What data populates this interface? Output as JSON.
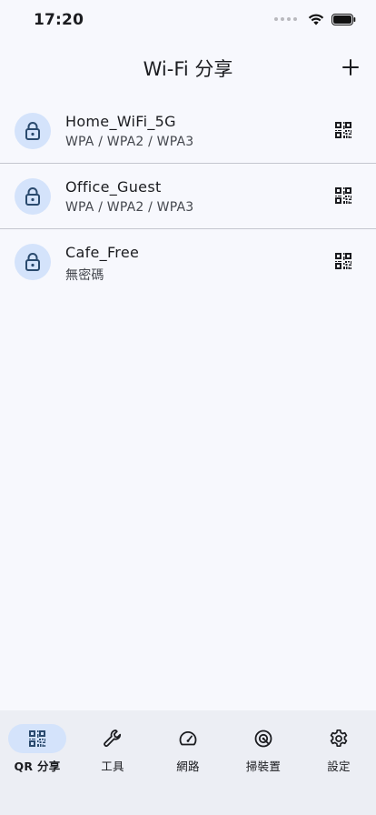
{
  "status_bar": {
    "time": "17:20"
  },
  "header": {
    "title": "Wi-Fi 分享"
  },
  "networks": [
    {
      "ssid": "Home_WiFi_5G",
      "security": "WPA / WPA2 / WPA3"
    },
    {
      "ssid": "Office_Guest",
      "security": "WPA / WPA2 / WPA3"
    },
    {
      "ssid": "Cafe_Free",
      "security": "無密碼"
    }
  ],
  "bottom_nav": {
    "items": [
      {
        "label": "QR 分享",
        "icon": "qr-code-icon",
        "active": true
      },
      {
        "label": "工具",
        "icon": "wrench-icon",
        "active": false
      },
      {
        "label": "網路",
        "icon": "speedometer-icon",
        "active": false
      },
      {
        "label": "掃裝置",
        "icon": "radar-icon",
        "active": false
      },
      {
        "label": "設定",
        "icon": "gear-icon",
        "active": false
      }
    ]
  },
  "colors": {
    "background": "#f7f8fd",
    "accent_container": "#d4e3fb",
    "icon_primary": "#2a4a6e",
    "nav_background": "#eceef4",
    "divider": "#c4c6cf"
  }
}
